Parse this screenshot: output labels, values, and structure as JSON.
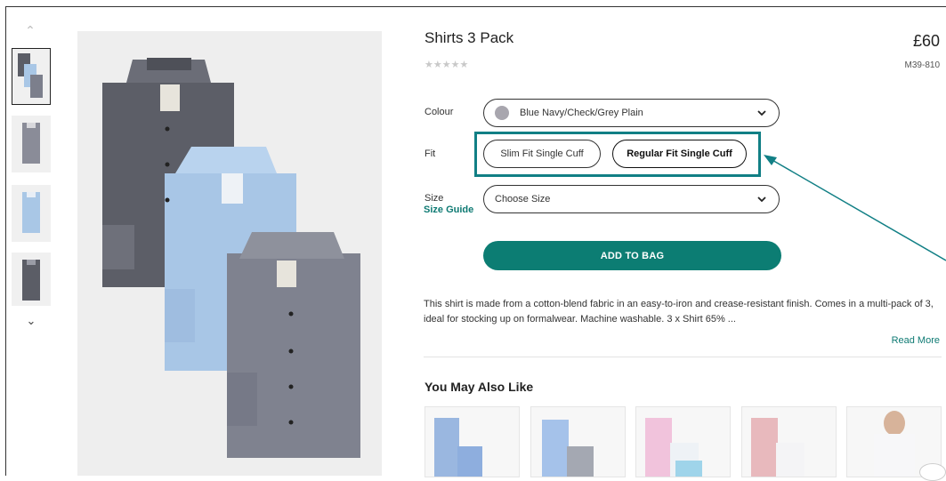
{
  "product": {
    "title": "Shirts 3 Pack",
    "price": "£60",
    "rating_stars": "★★★★★",
    "code": "M39-810"
  },
  "options": {
    "colour_label": "Colour",
    "colour_value": "Blue Navy/Check/Grey Plain",
    "fit_label": "Fit",
    "fit_options": [
      "Slim Fit Single Cuff",
      "Regular Fit Single Cuff"
    ],
    "fit_selected": "Regular Fit Single Cuff",
    "size_label": "Size",
    "size_placeholder": "Choose Size",
    "size_guide": "Size Guide"
  },
  "actions": {
    "add_to_bag": "ADD TO BAG",
    "read_more": "Read More"
  },
  "description": "This shirt is made from a cotton-blend fabric in an easy-to-iron and crease-resistant finish. Comes in a multi-pack of 3, ideal for stocking up on formalwear. Machine washable. 3 x Shirt 65% ...",
  "recommendations": {
    "heading": "You May Also Like"
  },
  "colors": {
    "accent": "#0c7d73",
    "highlight": "#117f85"
  }
}
